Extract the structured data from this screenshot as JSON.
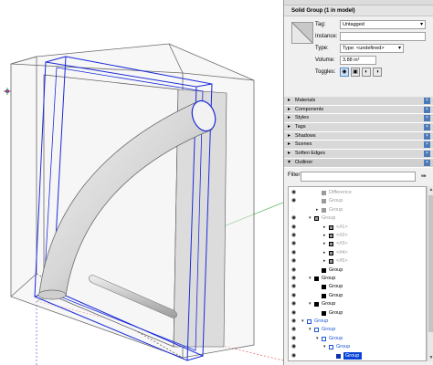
{
  "panel": {
    "top_strip": "",
    "entity_title": "Solid Group (1 in model)",
    "fields": {
      "tag_label": "Tag:",
      "tag_value": "Untagged",
      "instance_label": "Instance:",
      "instance_value": "",
      "type_label": "Type:",
      "type_value": "Type: <undefined>",
      "volume_label": "Volume:",
      "volume_value": "3.88 in³",
      "toggles_label": "Toggles:"
    },
    "trays": [
      {
        "label": "Materials"
      },
      {
        "label": "Components"
      },
      {
        "label": "Styles"
      },
      {
        "label": "Tags"
      },
      {
        "label": "Shadows"
      },
      {
        "label": "Scenes"
      },
      {
        "label": "Soften Edges"
      },
      {
        "label": "Outliner"
      }
    ],
    "filter_label": "Filter:",
    "outliner": [
      {
        "name": "Difference",
        "indent": 2,
        "icon": "solid",
        "style": "gray",
        "eye": "visible",
        "twisty": ""
      },
      {
        "name": "Group",
        "indent": 2,
        "icon": "solid",
        "style": "gray",
        "eye": "visible",
        "twisty": ""
      },
      {
        "name": "Group",
        "indent": 2,
        "icon": "solid",
        "style": "gray",
        "eye": "hidden",
        "twisty": "▸"
      },
      {
        "name": "Group",
        "indent": 1,
        "icon": "comp",
        "style": "gray",
        "eye": "visible",
        "twisty": "▾"
      },
      {
        "name": "<#1>",
        "indent": 3,
        "icon": "comp",
        "style": "gray",
        "eye": "visible",
        "twisty": "▸"
      },
      {
        "name": "<#2>",
        "indent": 3,
        "icon": "comp",
        "style": "gray",
        "eye": "visible",
        "twisty": "▸"
      },
      {
        "name": "<#3>",
        "indent": 3,
        "icon": "comp",
        "style": "gray",
        "eye": "visible",
        "twisty": "▸"
      },
      {
        "name": "<#4>",
        "indent": 3,
        "icon": "comp",
        "style": "gray",
        "eye": "visible",
        "twisty": "▸"
      },
      {
        "name": "<#5>",
        "indent": 3,
        "icon": "comp",
        "style": "gray",
        "eye": "visible",
        "twisty": "▸"
      },
      {
        "name": "Group",
        "indent": 2,
        "icon": "solid",
        "style": "black",
        "eye": "visible",
        "twisty": ""
      },
      {
        "name": "Group",
        "indent": 1,
        "icon": "solid",
        "style": "black",
        "eye": "visible",
        "twisty": "▾"
      },
      {
        "name": "Group",
        "indent": 2,
        "icon": "solid",
        "style": "black",
        "eye": "visible",
        "twisty": ""
      },
      {
        "name": "Group",
        "indent": 2,
        "icon": "solid",
        "style": "black",
        "eye": "visible",
        "twisty": ""
      },
      {
        "name": "Group",
        "indent": 1,
        "icon": "solid",
        "style": "black",
        "eye": "visible",
        "twisty": "▾"
      },
      {
        "name": "Group",
        "indent": 2,
        "icon": "solid",
        "style": "black",
        "eye": "visible",
        "twisty": ""
      },
      {
        "name": "Group",
        "indent": 0,
        "icon": "open",
        "style": "blue",
        "eye": "visible",
        "twisty": "▾"
      },
      {
        "name": "Group",
        "indent": 1,
        "icon": "open",
        "style": "blue",
        "eye": "visible",
        "twisty": "▾"
      },
      {
        "name": "Group",
        "indent": 2,
        "icon": "open",
        "style": "blue",
        "eye": "visible",
        "twisty": "▾"
      },
      {
        "name": "Group",
        "indent": 3,
        "icon": "open",
        "style": "blue",
        "eye": "visible",
        "twisty": "▾"
      },
      {
        "name": "Group",
        "indent": 4,
        "icon": "solid",
        "style": "sel",
        "eye": "visible",
        "twisty": ""
      }
    ]
  },
  "colors": {
    "selection_blue": "#0a44d6",
    "bbox_blue": "#1a2bd8",
    "axis_green": "#4caf50",
    "axis_red": "#d32f2f"
  }
}
